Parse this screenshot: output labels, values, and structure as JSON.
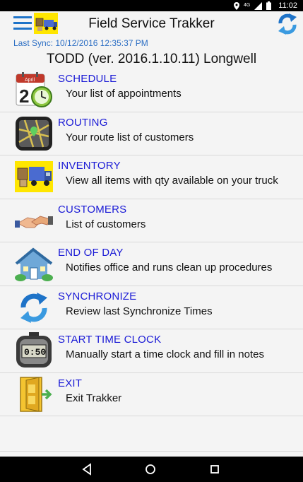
{
  "status_bar": {
    "time": "11:02",
    "signal_label": "4G"
  },
  "app_bar": {
    "title": "Field Service Trakker"
  },
  "last_sync": "Last Sync: 10/12/2016 12:35:37 PM",
  "user_line": "TODD (ver. 2016.1.10.11) Longwell",
  "menu": [
    {
      "title": "SCHEDULE",
      "description": "Your list of appointments",
      "icon": "calendar-clock-icon"
    },
    {
      "title": "ROUTING",
      "description": "Your route list of customers",
      "icon": "gps-map-icon"
    },
    {
      "title": "INVENTORY",
      "description": "View all items with qty available on your truck",
      "icon": "delivery-truck-icon"
    },
    {
      "title": "CUSTOMERS",
      "description": "List of customers",
      "icon": "handshake-icon"
    },
    {
      "title": "END OF DAY",
      "description": "Notifies office and runs clean up procedures",
      "icon": "house-icon"
    },
    {
      "title": "SYNCHRONIZE",
      "description": "Review last Synchronize Times",
      "icon": "sync-arrows-icon"
    },
    {
      "title": "START TIME CLOCK",
      "description": "Manually start a time clock and fill in notes",
      "icon": "stopwatch-icon"
    },
    {
      "title": "EXIT",
      "description": "Exit Trakker",
      "icon": "exit-door-icon"
    }
  ],
  "icon_texts": {
    "calendar_month": "April",
    "calendar_day": "2",
    "stopwatch_digits": "0:50"
  },
  "colors": {
    "accent_blue": "#1e73c8",
    "link_blue": "#1a1ad6",
    "sync_text": "#2d6fc4",
    "logo_yellow": "#ffe600"
  }
}
